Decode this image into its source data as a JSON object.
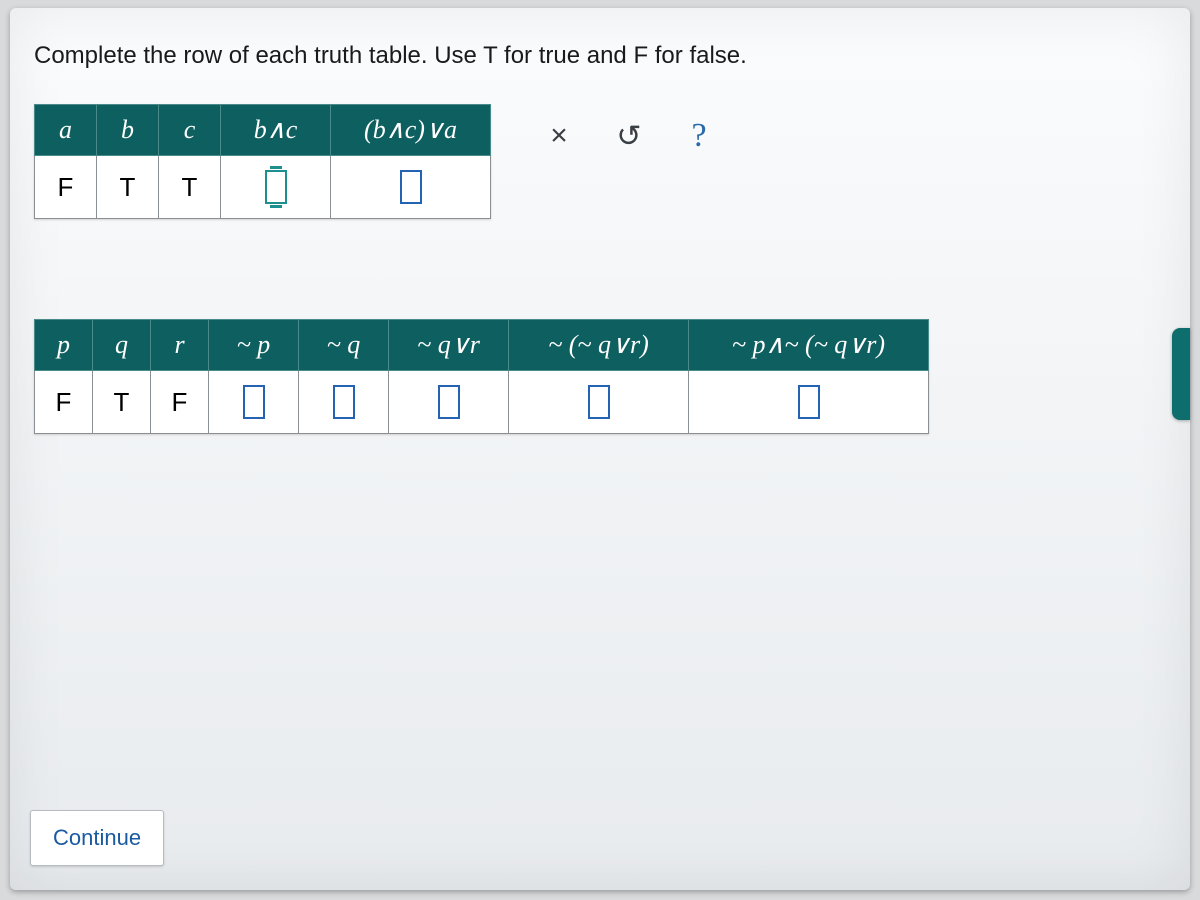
{
  "prompt": "Complete the row of each truth table. Use T for true and F for false.",
  "toolbar": {
    "reset_icon": "×",
    "undo_icon": "↺",
    "help_icon": "?"
  },
  "table1": {
    "headers": [
      "a",
      "b",
      "c",
      "b∧c",
      "(b∧c)∨a"
    ],
    "row": {
      "a": "F",
      "b": "T",
      "c": "T",
      "b_and_c": "",
      "bc_or_a": ""
    }
  },
  "table2": {
    "headers": [
      "p",
      "q",
      "r",
      "~ p",
      "~ q",
      "~ q∨r",
      "~ (~ q∨r)",
      "~ p∧~ (~ q∨r)"
    ],
    "row": {
      "p": "F",
      "q": "T",
      "r": "F",
      "not_p": "",
      "not_q": "",
      "notq_or_r": "",
      "not_notq_or_r": "",
      "final": ""
    }
  },
  "continue_label": "Continue"
}
